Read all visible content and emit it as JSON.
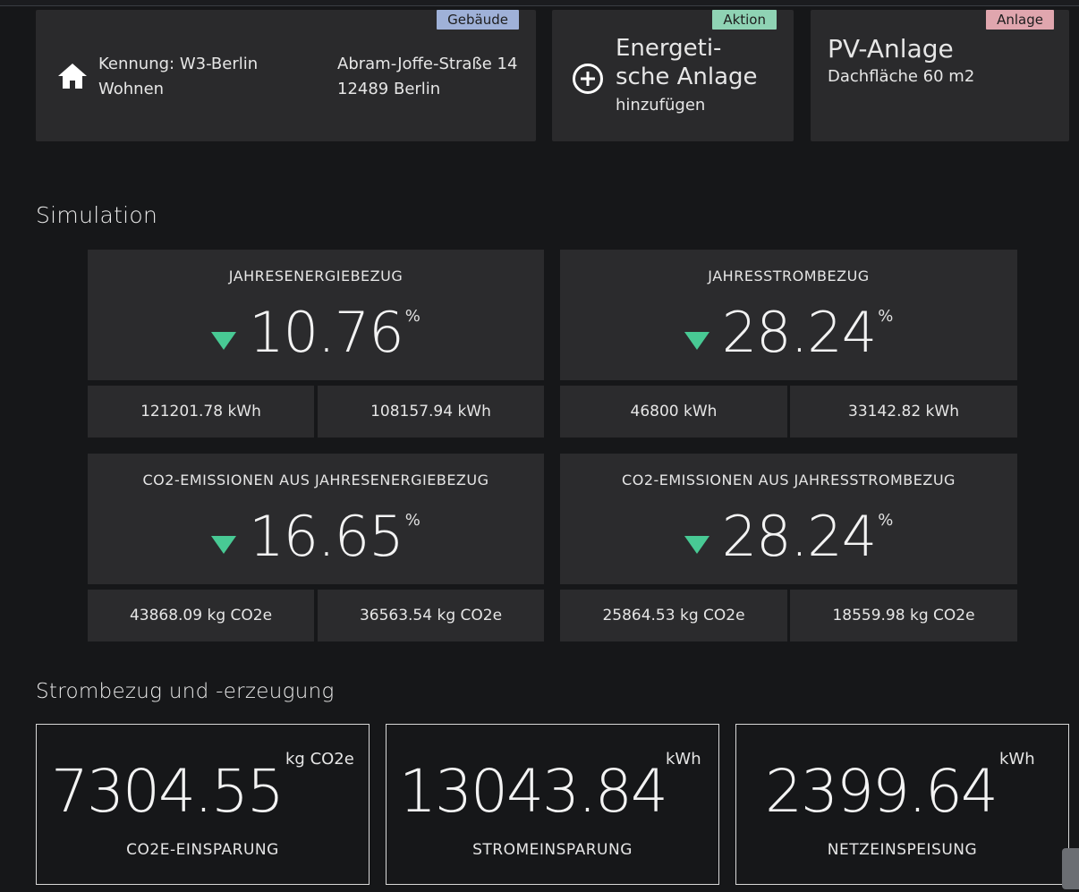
{
  "colors": {
    "tag_gebaeude": "#9fb1d8",
    "tag_aktion": "#8fd3b4",
    "tag_anlage": "#e0a6ae",
    "trend_down": "#48c994"
  },
  "building": {
    "tag": "Gebäude",
    "icon": "home-icon",
    "id_line": "Kennung: W3-Berlin",
    "usage": "Wohnen",
    "street": "Abram-Joffe-Straße 14",
    "city": "12489 Berlin"
  },
  "action": {
    "tag": "Aktion",
    "icon": "plus-circle-icon",
    "title_line1": "Energeti-",
    "title_line2": "sche Anlage",
    "subtitle": "hinzufügen"
  },
  "plant": {
    "tag": "Anlage",
    "title": "PV-Anlage",
    "subtitle": "Dachfläche 60 m2"
  },
  "simulation": {
    "title": "Simulation",
    "cards": [
      {
        "label": "JAHRESENERGIEBEZUG",
        "trend": "down",
        "value": "10.76",
        "unit": "%",
        "before": "121201.78 kWh",
        "after": "108157.94 kWh"
      },
      {
        "label": "JAHRESSTROMBEZUG",
        "trend": "down",
        "value": "28.24",
        "unit": "%",
        "before": "46800 kWh",
        "after": "33142.82 kWh"
      },
      {
        "label": "CO2-EMISSIONEN AUS JAHRESENERGIEBEZUG",
        "trend": "down",
        "value": "16.65",
        "unit": "%",
        "before": "43868.09 kg CO2e",
        "after": "36563.54 kg CO2e"
      },
      {
        "label": "CO2-EMISSIONEN AUS JAHRESSTROMBEZUG",
        "trend": "down",
        "value": "28.24",
        "unit": "%",
        "before": "25864.53 kg CO2e",
        "after": "18559.98 kg CO2e"
      }
    ]
  },
  "electricity": {
    "title": "Strombezug und -erzeugung",
    "stats": [
      {
        "value": "7304.55",
        "unit": "kg CO2e",
        "caption": "CO2E-EINSPARUNG"
      },
      {
        "value": "13043.84",
        "unit": "kWh",
        "caption": "STROMEINSPARUNG"
      },
      {
        "value": "2399.64",
        "unit": "kWh",
        "caption": "NETZEINSPEISUNG"
      }
    ]
  }
}
